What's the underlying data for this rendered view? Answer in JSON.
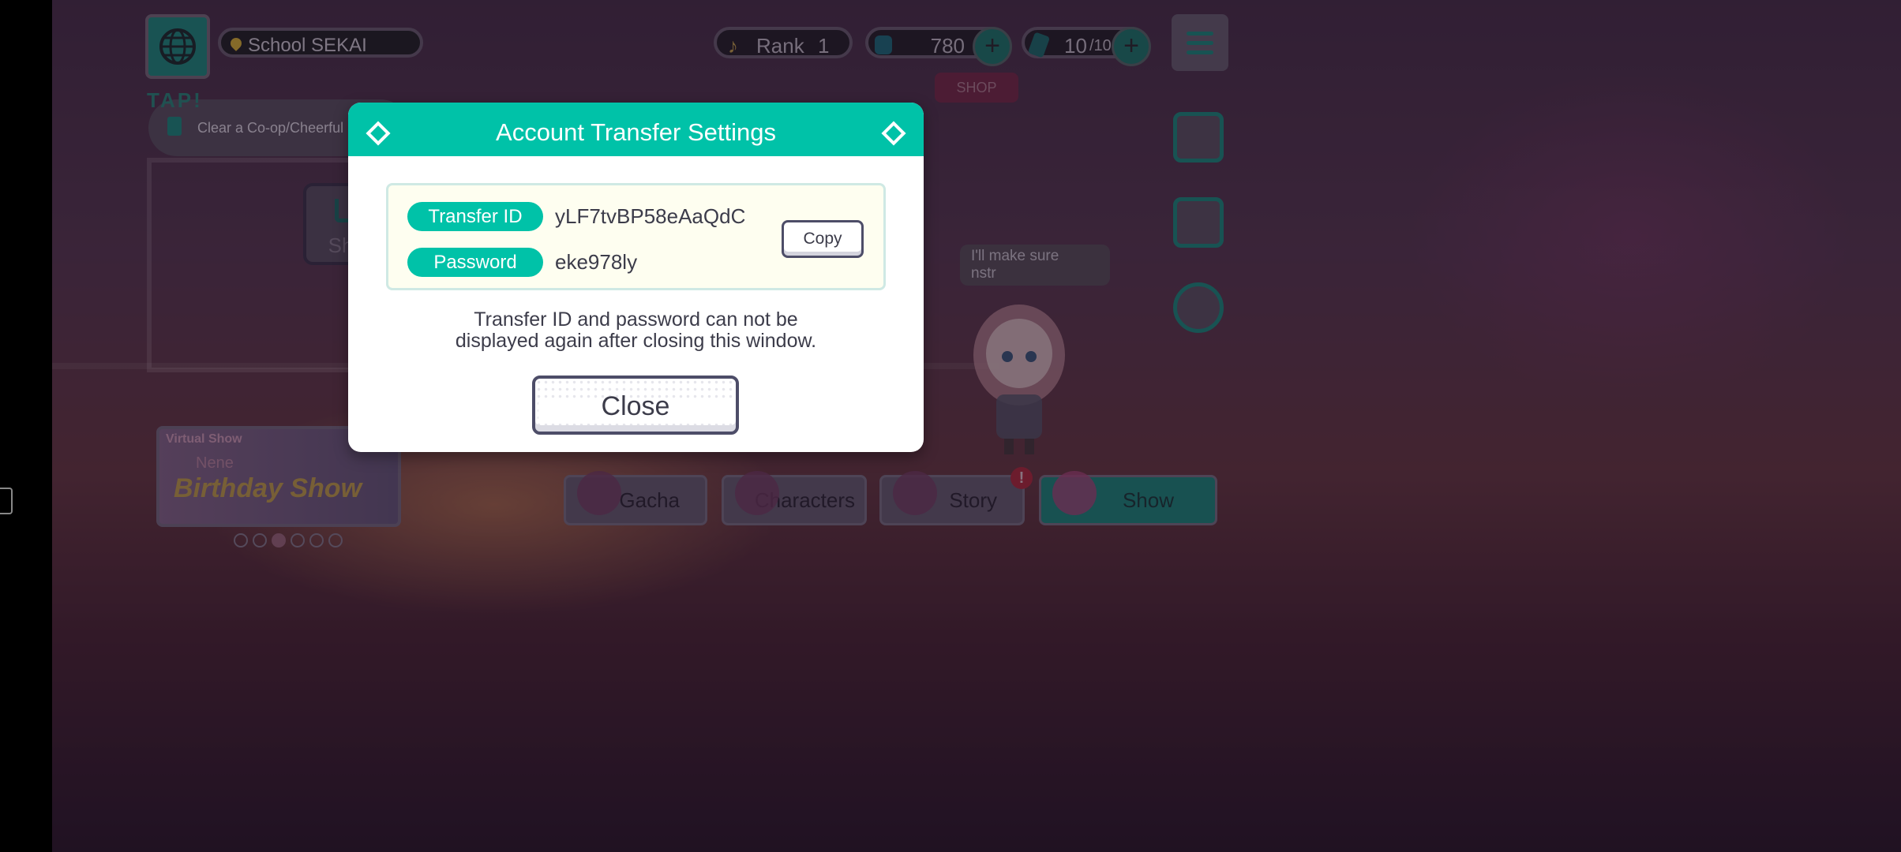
{
  "top_bar": {
    "location": "School SEKAI",
    "rank_label": "Rank",
    "rank_value": "1",
    "coins": "780",
    "energy_current": "10",
    "energy_max": "/10",
    "plus": "+",
    "shop_tag": "SHOP"
  },
  "mission": {
    "tap_label": "TAP!",
    "text": "Clear a Co-op/Cheerful Show."
  },
  "background": {
    "shop_bubble": "Shop",
    "speech_line1": "I'll make sure",
    "speech_line2": "nstr"
  },
  "bottom_nav": {
    "gacha": "Gacha",
    "characters": "Characters",
    "story": "Story",
    "show": "Show",
    "story_alert": "!"
  },
  "banner": {
    "label": "Virtual Show",
    "name": "Nene",
    "title": "Birthday Show"
  },
  "modal": {
    "title": "Account Transfer Settings",
    "transfer_id_label": "Transfer ID",
    "transfer_id_value": "yLF7tvBP58eAaQdC",
    "password_label": "Password",
    "password_value": "eke978ly",
    "copy_label": "Copy",
    "notice_line1": "Transfer ID and password can not be",
    "notice_line2": "displayed again after closing this window.",
    "close_label": "Close"
  },
  "colors": {
    "accent": "#00c2a8",
    "text_dark": "#3c3c4a",
    "info_box_bg": "#fefef0"
  }
}
